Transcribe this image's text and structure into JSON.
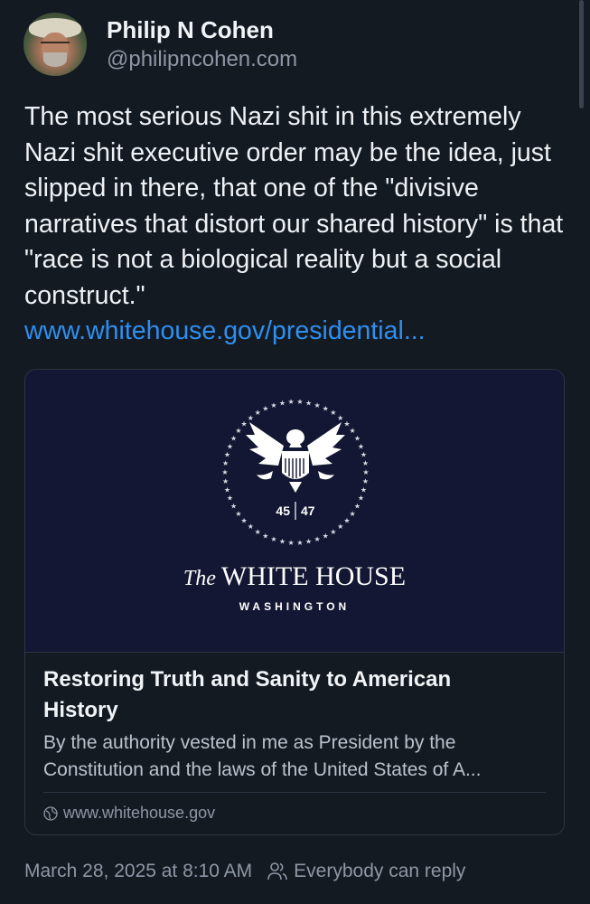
{
  "author": {
    "display_name": "Philip N Cohen",
    "handle": "@philipncohen.com"
  },
  "post": {
    "text": "The most serious Nazi shit in this extremely Nazi shit executive order may be the idea, just slipped in there, that one of the \"divisive narratives that distort our shared history\" is that \"race is not a biological reality but a social construct.\"",
    "link_text": "www.whitehouse.gov/presidential..."
  },
  "card": {
    "image": {
      "seal_numbers_left": "45",
      "seal_numbers_right": "47",
      "title_the": "The",
      "title_main": "WHITE HOUSE",
      "subtitle": "WASHINGTON"
    },
    "title": "Restoring Truth and Sanity to American History",
    "description": "By the authority vested in me as President by the Constitution and the laws of the United States of A...",
    "domain": "www.whitehouse.gov"
  },
  "meta": {
    "timestamp": "March 28, 2025 at 8:10 AM",
    "reply_setting": "Everybody can reply"
  },
  "colors": {
    "background": "#141a22",
    "link": "#2f8ff0",
    "muted": "#8d97a5",
    "card_image_bg": "#141733"
  },
  "icons": {
    "reply_setting": "people-icon",
    "domain": "globe-icon"
  }
}
